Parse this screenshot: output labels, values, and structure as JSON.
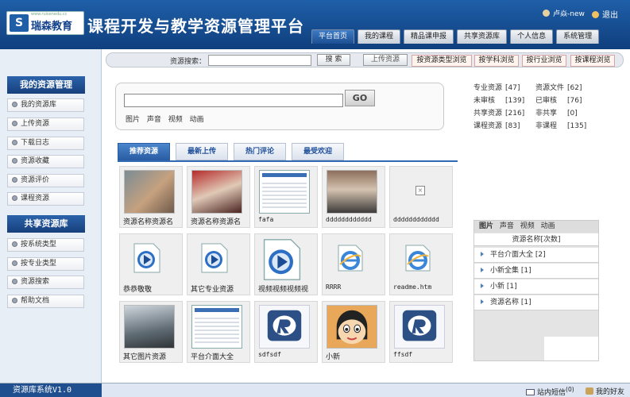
{
  "header": {
    "logo_url": "www.ruisenedu.cc",
    "logo_mark": "S",
    "logo_text": "瑞森教育",
    "title": "课程开发与教学资源管理平台",
    "user": "卢焱-new",
    "logout": "退出"
  },
  "nav": [
    "平台首页",
    "我的课程",
    "精品课申报",
    "共享资源库",
    "个人信息",
    "系统管理"
  ],
  "sidebar": {
    "my_head": "我的资源管理",
    "my_items": [
      "我的资源库",
      "上传资源",
      "下载日志",
      "资源收藏",
      "资源评价",
      "课程资源"
    ],
    "shared_head": "共享资源库",
    "shared_items": [
      "按系统类型",
      "按专业类型",
      "资源搜索",
      "帮助文档"
    ]
  },
  "searchbar": {
    "label": "资源搜索：",
    "value": "",
    "search_btn": "搜 索",
    "upload_btn": "上传资源",
    "browse": [
      "按资源类型浏览",
      "按学科浏览",
      "按行业浏览",
      "按课程浏览"
    ]
  },
  "main_search": {
    "value": "",
    "go": "GO",
    "types": [
      "图片",
      "声音",
      "视频",
      "动画"
    ]
  },
  "content_tabs": [
    "推荐资源",
    "最新上传",
    "热门评论",
    "最受欢迎"
  ],
  "resources": [
    {
      "caption": "资源名称资源名",
      "thumb": "photo1"
    },
    {
      "caption": "资源名称资源名",
      "thumb": "photo2"
    },
    {
      "caption": "fafa",
      "thumb": "shot"
    },
    {
      "caption": "dddddddddddd",
      "thumb": "photo3"
    },
    {
      "caption": "dddddddddddd",
      "thumb": "blank"
    },
    {
      "caption": "恭恭敬敬",
      "thumb": "video"
    },
    {
      "caption": "其它专业资源",
      "thumb": "video"
    },
    {
      "caption": "视频视频视频视",
      "thumb": "video-big"
    },
    {
      "caption": "RRRR",
      "thumb": "ie"
    },
    {
      "caption": "readme.htm",
      "thumb": "ie"
    },
    {
      "caption": "其它图片资源",
      "thumb": "plane"
    },
    {
      "caption": "平台介面大全",
      "thumb": "shot"
    },
    {
      "caption": "sdfsdf",
      "thumb": "real"
    },
    {
      "caption": "小新",
      "thumb": "cartoon"
    },
    {
      "caption": "ffsdf",
      "thumb": "real"
    }
  ],
  "stats": [
    {
      "label": "专业资源",
      "value": "[47]",
      "label2": "资源文件",
      "value2": "[62]"
    },
    {
      "label": "未审核",
      "value": "[139]",
      "label2": "已审核",
      "value2": "[76]"
    },
    {
      "label": "共享资源",
      "value": "[216]",
      "label2": "非共享",
      "value2": "[0]"
    },
    {
      "label": "课程资源",
      "value": "[83]",
      "label2": "非课程",
      "value2": "[135]"
    }
  ],
  "category_panel": {
    "tabs": [
      "图片",
      "声音",
      "视频",
      "动画"
    ],
    "header": "资源名称[次数]",
    "rows": [
      "平台介面大全 [2]",
      "小新全集 [1]",
      "小新 [1]",
      "资源名称 [1]"
    ]
  },
  "footer": {
    "version": "资源库系统V1.0",
    "messages": "站内短信",
    "message_count": "(0)",
    "friends": "我的好友"
  },
  "colors": {
    "brand": "#1f5fa8",
    "active_tab": "#2a5da4"
  }
}
